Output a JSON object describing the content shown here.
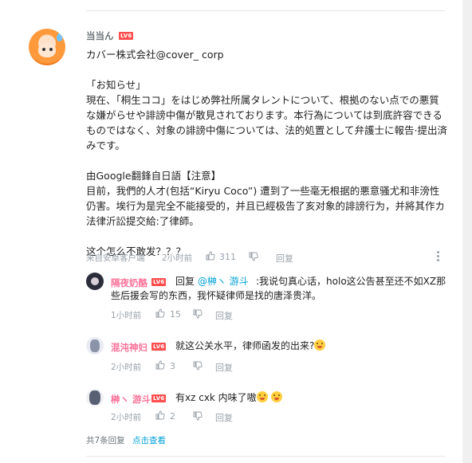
{
  "main_comment": {
    "username": "当当ん",
    "level": "LV6",
    "content": "カバー株式会社@cover_ corp\n\n「お知らせ」\n現在、「桐生ココ」をはじめ弊社所属タレントについて、根拠のない点での悪質な嫌がらせや誹謗中傷が散見されております。本行為については到底許容できるものではなく、対象の誹謗中傷については、法的処置として弁護士に報告·提出済みです。\n\n由Google翻鋒自日語【注意】\n目前，我們的人才(包括“Kiryu Coco”) 遭到了一些毫无根据的悪意骚尤和非滂性仍害。埃行为是完全不能接受的，并且已經极告了亥对象的誹謗行为，并將其作カ法律沂訟提交給:了律師。\n\n这个怎么不敢发？？？",
    "device": "来自安卓客户端",
    "time": "2小时前",
    "likes": "311",
    "reply_label": "回复"
  },
  "replies": [
    {
      "username": "隔夜奶酪",
      "level": "LV6",
      "prefix": "回复 ",
      "mention": "@榊ヽ 游斗",
      "text": " :我说句真心话，holo这公告甚至还不如XZ那些后援会写的东西，我怀疑律师是找的唐泽贵洋。",
      "time": "1小时前",
      "likes": "15",
      "reply_label": "回复"
    },
    {
      "username": "混沌神妇",
      "level": "LV6",
      "text": "就这公关水平，律师函发的出来?",
      "time": "2小时前",
      "likes": "3",
      "reply_label": "回复"
    },
    {
      "username": "榊ヽ 游斗",
      "level": "LV6",
      "text": "有xz  cxk  内味了嗷",
      "time": "2小时前",
      "likes": "2",
      "reply_label": "回复"
    }
  ],
  "footer": {
    "count": "共7条回复",
    "view_more": "点击查看"
  },
  "colors": {
    "accent": "#00a1d6",
    "pink": "#fb7299",
    "level_badge": "#ff4d4d"
  }
}
